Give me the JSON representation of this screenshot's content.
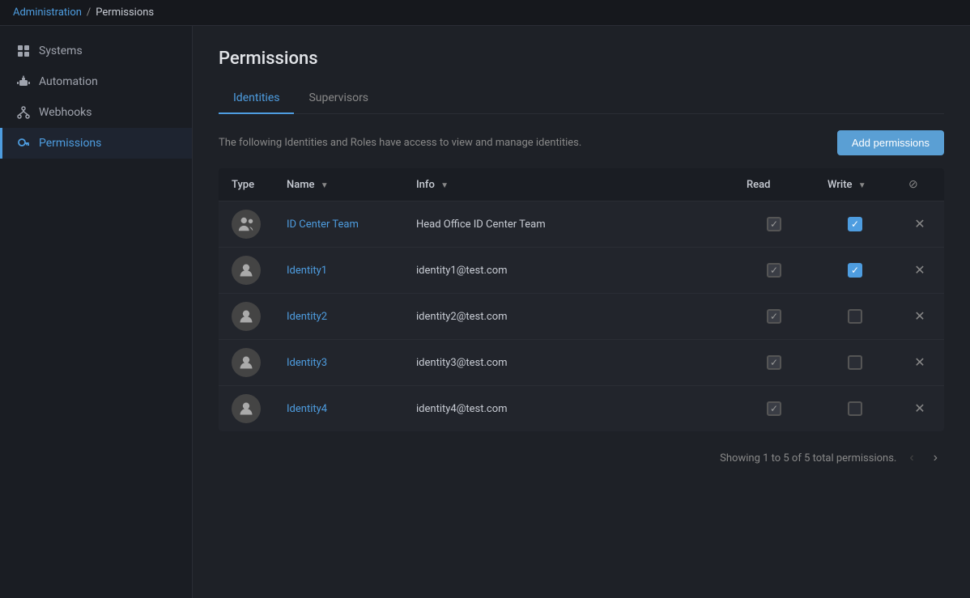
{
  "breadcrumb": {
    "parent": "Administration",
    "separator": "/",
    "current": "Permissions"
  },
  "sidebar": {
    "items": [
      {
        "id": "systems",
        "label": "Systems",
        "icon": "grid-icon",
        "active": false
      },
      {
        "id": "automation",
        "label": "Automation",
        "icon": "robot-icon",
        "active": false
      },
      {
        "id": "webhooks",
        "label": "Webhooks",
        "icon": "webhook-icon",
        "active": false
      },
      {
        "id": "permissions",
        "label": "Permissions",
        "icon": "key-icon",
        "active": true
      }
    ]
  },
  "page": {
    "title": "Permissions",
    "description_part1": "The following Identities and Roles have access to view and manage identities."
  },
  "tabs": [
    {
      "id": "identities",
      "label": "Identities",
      "active": true
    },
    {
      "id": "supervisors",
      "label": "Supervisors",
      "active": false
    }
  ],
  "add_button": "Add permissions",
  "table": {
    "headers": {
      "type": "Type",
      "name": "Name",
      "info": "Info",
      "read": "Read",
      "write": "Write",
      "delete": ""
    },
    "rows": [
      {
        "id": 1,
        "type": "group",
        "name": "ID Center Team",
        "info": "Head Office ID Center Team",
        "read": "checked-gray",
        "write": "checked-blue"
      },
      {
        "id": 2,
        "type": "person",
        "name": "Identity1",
        "info": "identity1@test.com",
        "read": "checked-gray",
        "write": "checked-blue"
      },
      {
        "id": 3,
        "type": "person",
        "name": "Identity2",
        "info": "identity2@test.com",
        "read": "checked-gray",
        "write": "unchecked"
      },
      {
        "id": 4,
        "type": "person",
        "name": "Identity3",
        "info": "identity3@test.com",
        "read": "checked-gray",
        "write": "unchecked"
      },
      {
        "id": 5,
        "type": "person",
        "name": "Identity4",
        "info": "identity4@test.com",
        "read": "checked-gray",
        "write": "unchecked"
      }
    ]
  },
  "pagination": {
    "status": "Showing 1 to 5 of 5 total permissions."
  }
}
